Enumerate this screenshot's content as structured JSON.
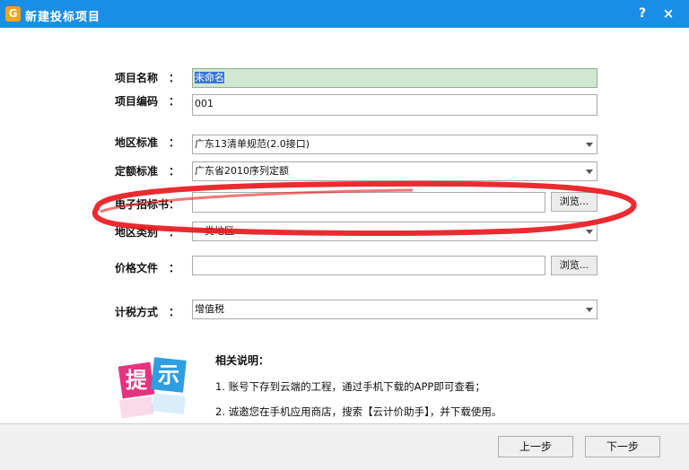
{
  "window": {
    "title": "新建投标项目",
    "help_label": "?",
    "close_label": "×",
    "app_icon": "app-logo-icon"
  },
  "form": {
    "project_name": {
      "label": "项目名称",
      "colon": "：",
      "value": "未命名"
    },
    "project_code": {
      "label": "项目编码",
      "colon": "：",
      "value": "001"
    },
    "region_standard": {
      "label": "地区标准",
      "colon": "：",
      "value": "广东13清单规范(2.0接口)"
    },
    "quota_standard": {
      "label": "定额标准",
      "colon": "：",
      "value": "广东省2010序列定额"
    },
    "tender_doc": {
      "label": "电子招标书",
      "colon": "：",
      "value": "",
      "browse_label": "浏览..."
    },
    "region_type": {
      "label": "地区类别",
      "colon": "：",
      "value": "一类地区"
    },
    "price_file": {
      "label": "价格文件",
      "colon": "：",
      "value": "",
      "browse_label": "浏览..."
    },
    "tax_method": {
      "label": "计税方式",
      "colon": "：",
      "value": "增值税"
    }
  },
  "hint": {
    "badge_chars": [
      "提",
      "示"
    ],
    "title": "相关说明：",
    "lines": [
      "1. 账号下存到云端的工程，通过手机下载的APP即可查看；",
      "2. 诚邀您在手机应用商店，搜索【云计价助手】，并下载使用。"
    ]
  },
  "footer": {
    "prev_label": "上一步",
    "next_label": "下一步"
  },
  "colors": {
    "titlebar": "#1a8ee6",
    "annotation": "#e8191e",
    "selected_field": "#cfe8cf"
  }
}
